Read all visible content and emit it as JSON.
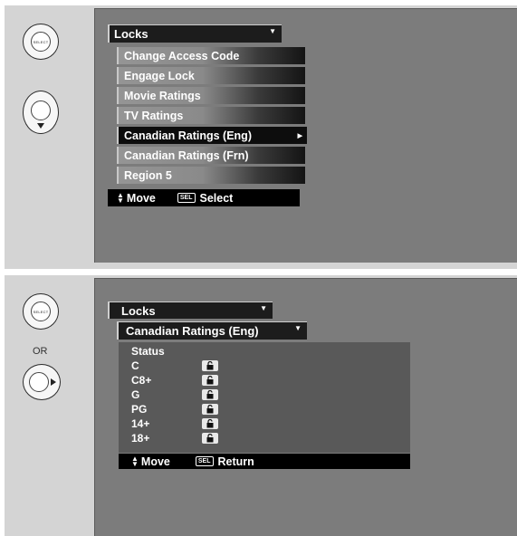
{
  "top": {
    "menu_title": "Locks",
    "items": [
      {
        "label": "Change Access Code",
        "selected": false,
        "has_submenu": false
      },
      {
        "label": "Engage Lock",
        "selected": false,
        "has_submenu": false
      },
      {
        "label": "Movie Ratings",
        "selected": false,
        "has_submenu": false
      },
      {
        "label": "TV Ratings",
        "selected": false,
        "has_submenu": false
      },
      {
        "label": "Canadian Ratings (Eng)",
        "selected": true,
        "has_submenu": true
      },
      {
        "label": "Canadian Ratings (Frn)",
        "selected": false,
        "has_submenu": false
      },
      {
        "label": "Region 5",
        "selected": false,
        "has_submenu": false
      }
    ],
    "hint": {
      "move": "Move",
      "key": "SEL",
      "action": "Select"
    },
    "remote": {
      "select_label": "SELECT"
    }
  },
  "bottom": {
    "menu_title": "Locks",
    "submenu_title": "Canadian Ratings (Eng)",
    "status_header": "Status",
    "ratings": [
      {
        "label": "C",
        "lock_icon": "unlocked-padlock-icon"
      },
      {
        "label": "C8+",
        "lock_icon": "unlocked-padlock-icon"
      },
      {
        "label": "G",
        "lock_icon": "unlocked-padlock-icon"
      },
      {
        "label": "PG",
        "lock_icon": "unlocked-padlock-icon"
      },
      {
        "label": "14+",
        "lock_icon": "unlocked-padlock-icon"
      },
      {
        "label": "18+",
        "lock_icon": "unlocked-padlock-icon"
      }
    ],
    "hint": {
      "move": "Move",
      "key": "SEL",
      "action": "Return"
    },
    "remote": {
      "select_label": "SELECT",
      "or_label": "OR"
    }
  },
  "colors": {
    "panel_bg": "#d4d4d4",
    "screen_bg": "#7c7c7c",
    "bar_dark": "#000000"
  }
}
